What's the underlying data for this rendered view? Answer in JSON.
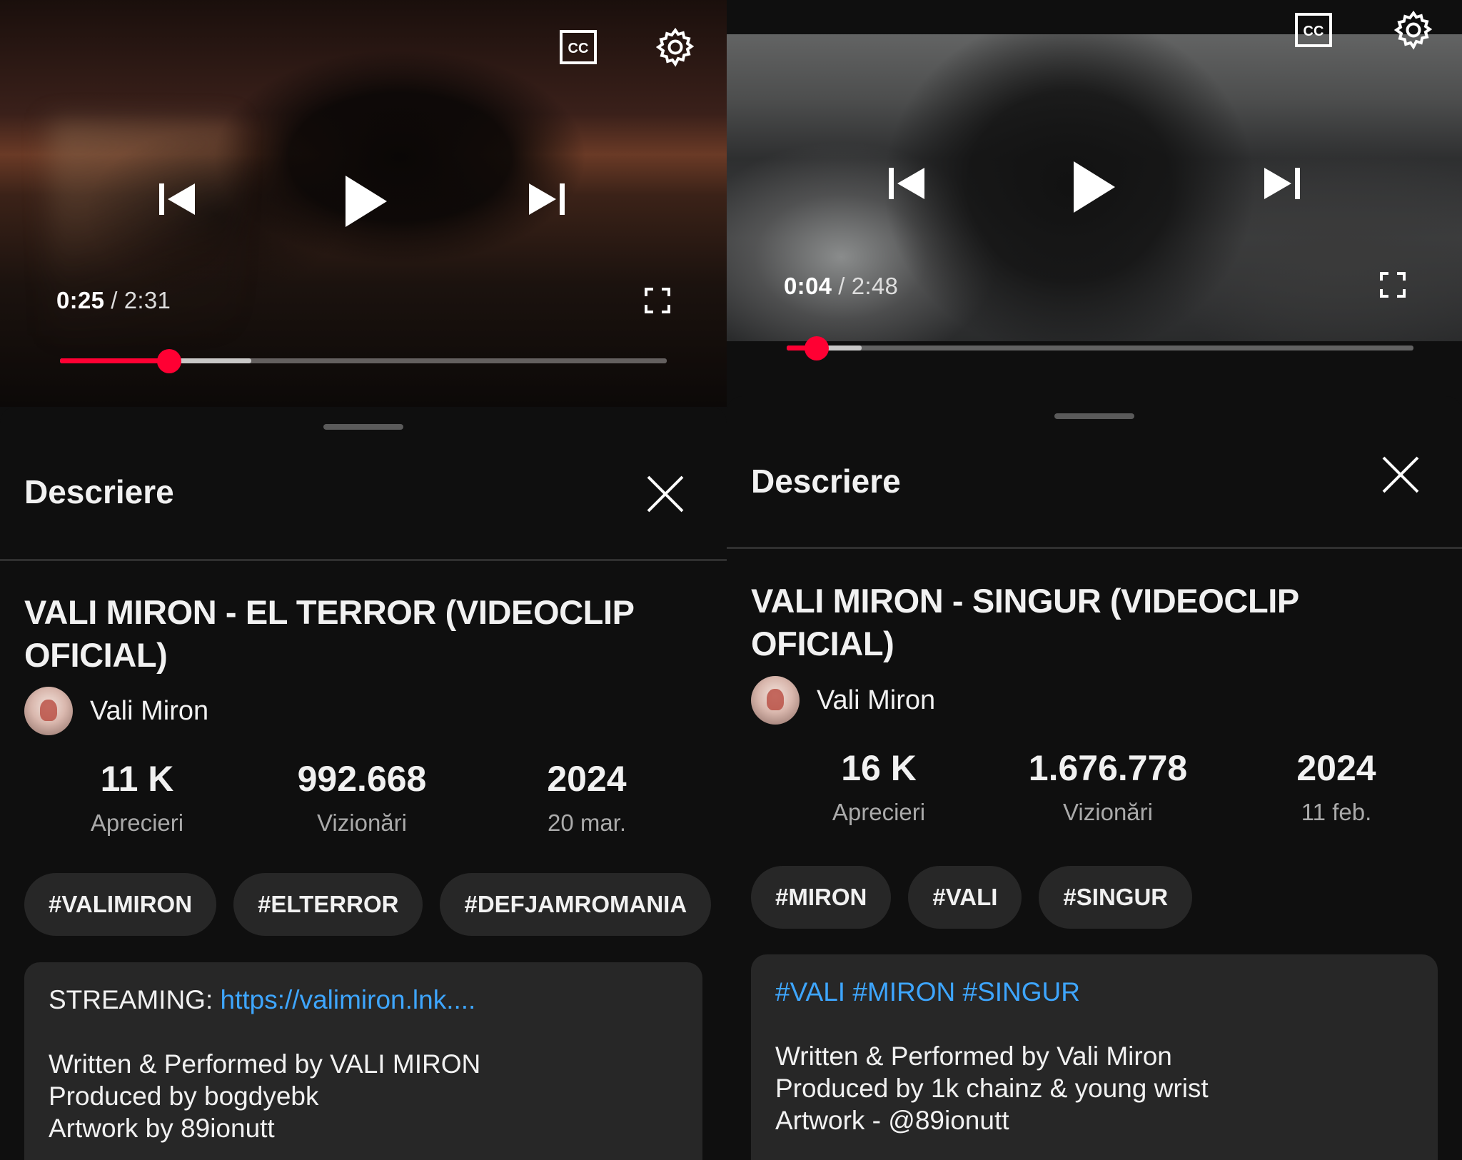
{
  "screens": [
    {
      "player": {
        "current_time": "0:25",
        "separator": "/",
        "duration": "2:31",
        "progress_fraction": 0.18,
        "buffered_fraction": 0.315
      },
      "sheet": {
        "title": "Descriere",
        "video_title": "VALI MIRON - EL TERROR (VIDEOCLIP OFICIAL)",
        "channel_name": "Vali Miron",
        "stats": [
          {
            "value": "11 K",
            "label": "Aprecieri"
          },
          {
            "value": "992.668",
            "label": "Vizionări"
          },
          {
            "value": "2024",
            "label": "20 mar."
          }
        ],
        "tags": [
          "#VALIMIRON",
          "#ELTERROR",
          "#DEFJAMROMANIA"
        ],
        "description": {
          "streaming_label": "STREAMING: ",
          "streaming_link": "https://valimiron.lnk....",
          "lines": [
            "Written & Performed by VALI MIRON",
            "Produced by bogdyebk",
            "Artwork by 89ionutt"
          ]
        }
      }
    },
    {
      "player": {
        "current_time": "0:04",
        "separator": "/",
        "duration": "2:48",
        "progress_fraction": 0.048,
        "buffered_fraction": 0.12
      },
      "sheet": {
        "title": "Descriere",
        "video_title": "VALI MIRON - SINGUR (VIDEOCLIP OFICIAL)",
        "channel_name": "Vali Miron",
        "stats": [
          {
            "value": "16 K",
            "label": "Aprecieri"
          },
          {
            "value": "1.676.778",
            "label": "Vizionări"
          },
          {
            "value": "2024",
            "label": "11 feb."
          }
        ],
        "tags": [
          "#MIRON",
          "#VALI",
          "#SINGUR"
        ],
        "description": {
          "hashtags_line": "#VALI #MIRON #SINGUR",
          "lines": [
            "Written & Performed by Vali Miron",
            "Produced by 1k chainz & young wrist",
            "Artwork - @89ionutt"
          ]
        }
      }
    }
  ]
}
